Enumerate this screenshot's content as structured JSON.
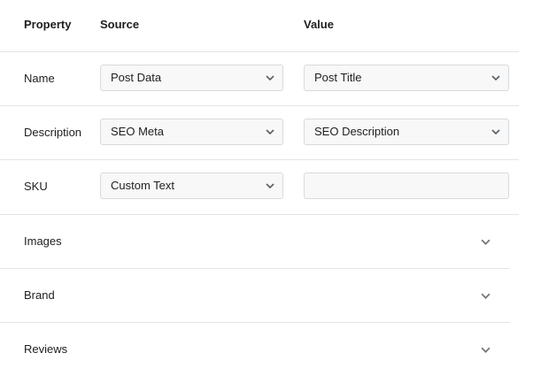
{
  "header": {
    "property": "Property",
    "source": "Source",
    "value": "Value"
  },
  "rows": [
    {
      "label": "Name",
      "source": "Post Data",
      "value": "Post Title"
    },
    {
      "label": "Description",
      "source": "SEO Meta",
      "value": "SEO Description"
    },
    {
      "label": "SKU",
      "source": "Custom Text",
      "value": ""
    }
  ],
  "collapsible": [
    {
      "label": "Images"
    },
    {
      "label": "Brand"
    },
    {
      "label": "Reviews"
    }
  ],
  "icons": {
    "select_caret": "chevron-down-icon",
    "row_expand": "chevron-down-icon"
  },
  "colors": {
    "border": "#e2e4e7",
    "field_bg": "#f8f8f8",
    "field_border": "#d7dade",
    "chevron": "#757575"
  }
}
